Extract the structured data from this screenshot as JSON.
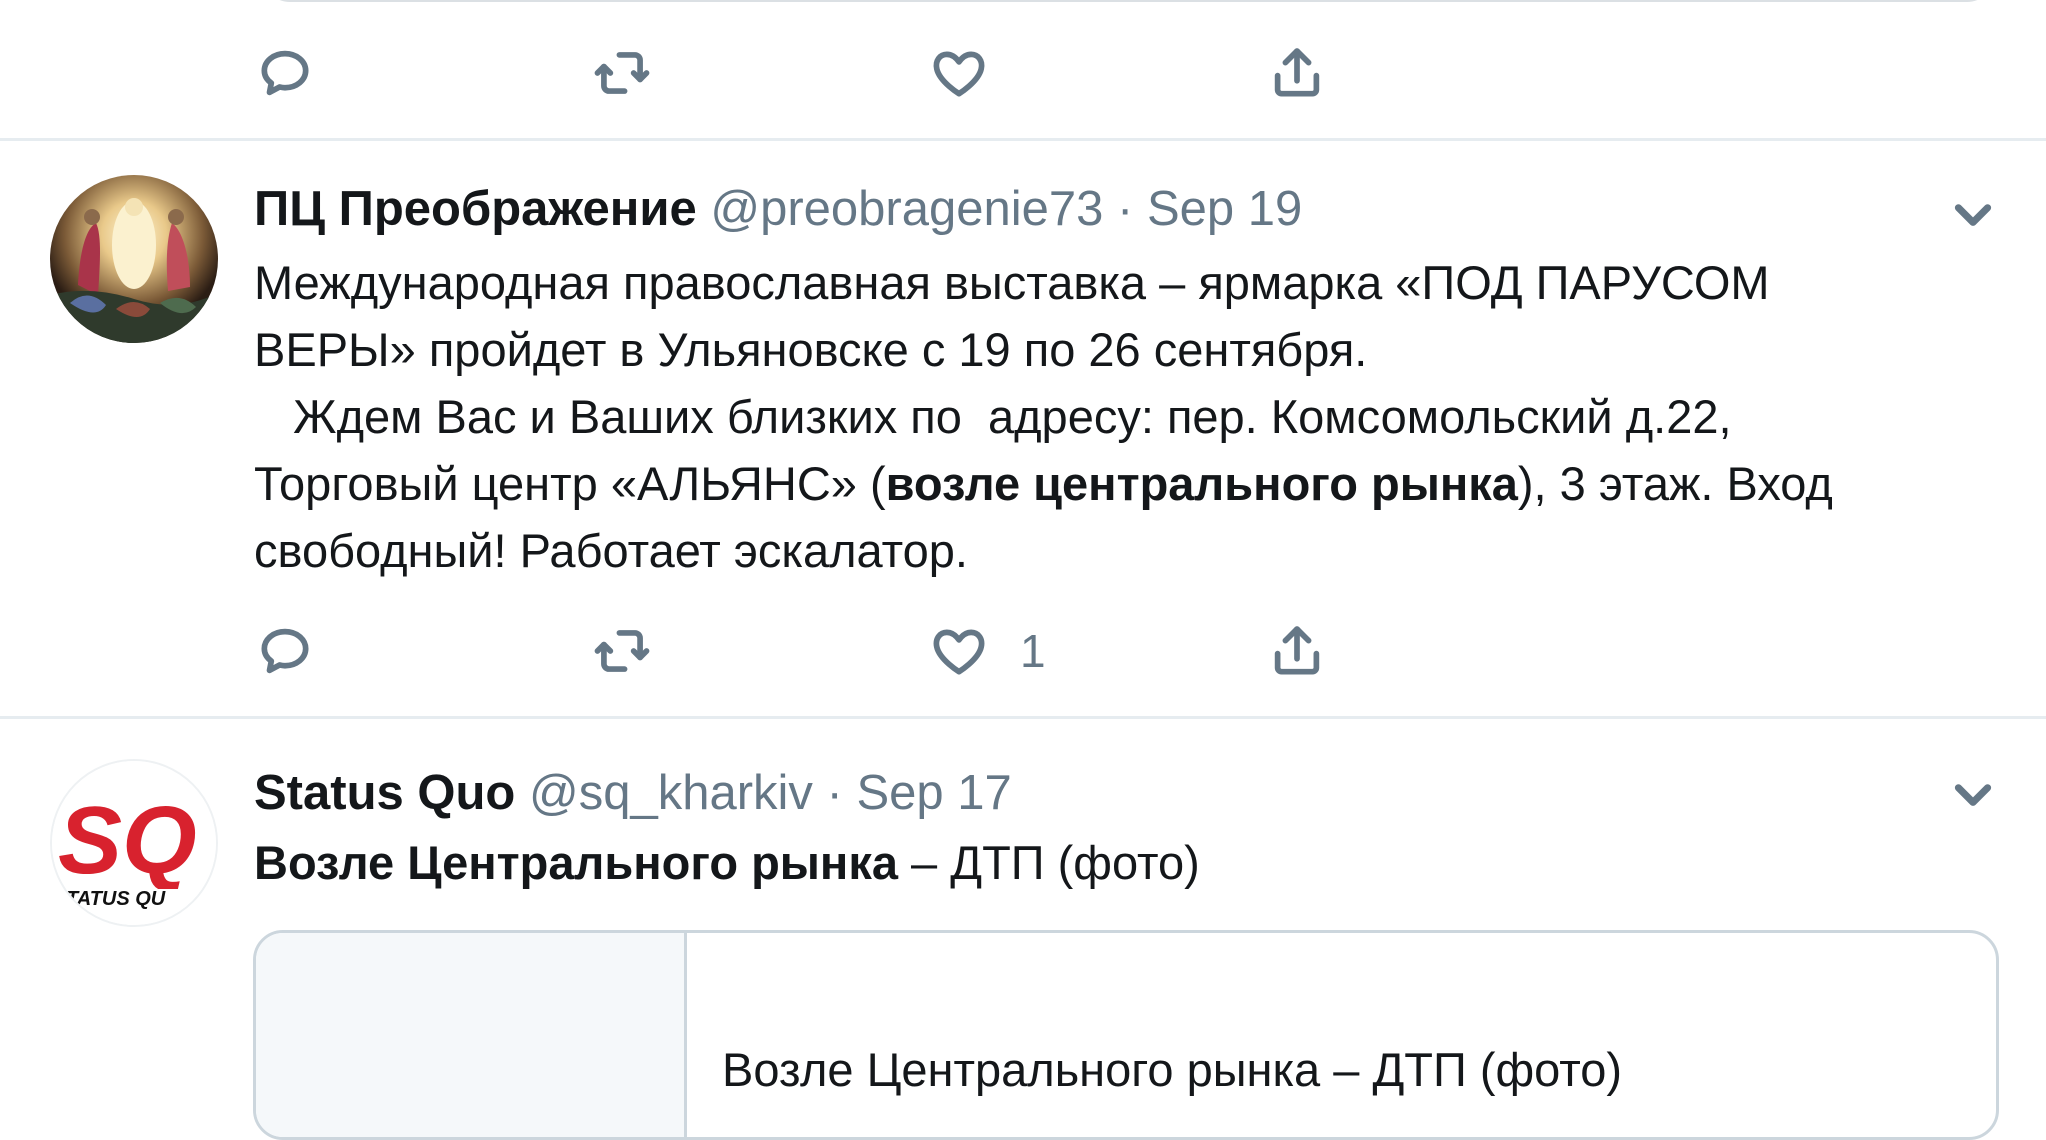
{
  "tweets": [
    {
      "display_name": "ПЦ Преображение",
      "handle": "@preobragenie73",
      "separator": "·",
      "date": "Sep 19",
      "text_lines": [
        {
          "pre": "Международная православная выставка – ярмарка «ПОД ПАРУСОМ",
          "bold": "",
          "post": ""
        },
        {
          "pre": "ВЕРЫ» пройдет в Ульяновске с 19 по 26 сентября.",
          "bold": "",
          "post": ""
        },
        {
          "pre": "   Ждем Вас и Ваших близких по  адресу: пер. Комсомольский д.22,",
          "bold": "",
          "post": ""
        },
        {
          "pre": "Торговый центр «АЛЬЯНС» (",
          "bold": "возле центрального рынка",
          "post": "), 3 этаж. Вход"
        },
        {
          "pre": "свободный! Работает эскалатор.",
          "bold": "",
          "post": ""
        }
      ],
      "like_count": "1"
    },
    {
      "display_name": "Status Quo",
      "handle": "@sq_kharkiv",
      "separator": "·",
      "date": "Sep 17",
      "text_bold": "Возле Центрального рынка",
      "text_rest": " – ДТП (фото)",
      "card_title": "Возле Центрального рынка – ДТП (фото)",
      "avatar_logo_text": "SQ",
      "avatar_caption": "TATUS QU"
    }
  ],
  "icons": {
    "reply": "reply-icon",
    "retweet": "retweet-icon",
    "like": "like-icon",
    "share": "share-icon",
    "chevron": "chevron-down-icon"
  },
  "colors": {
    "text": "#14171a",
    "secondary": "#657786",
    "border": "#e6ecf0",
    "card_border": "#ccd6dd",
    "sq_red": "#d8222e"
  }
}
